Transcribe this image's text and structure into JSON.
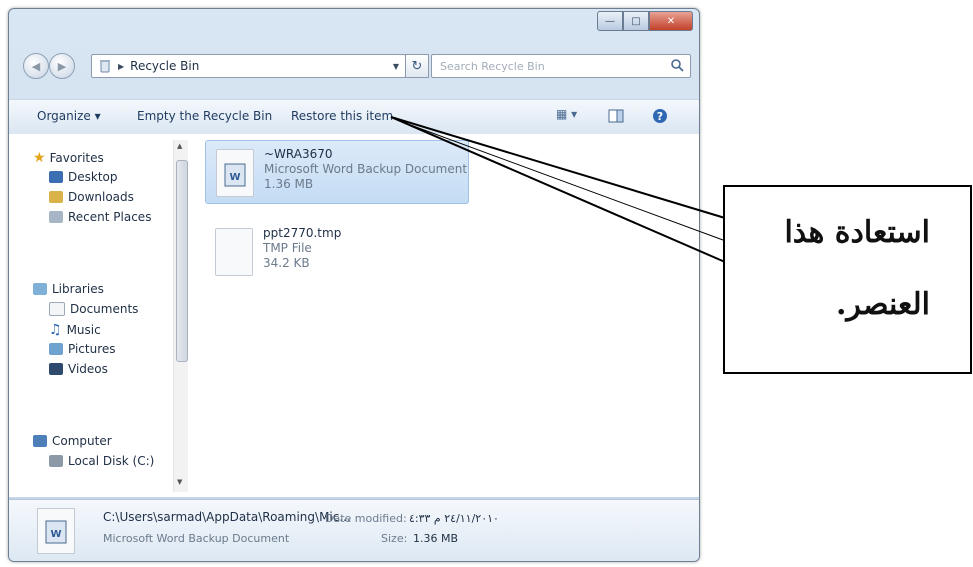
{
  "window": {
    "address": {
      "path": "Recycle Bin"
    },
    "search": {
      "placeholder": "Search Recycle Bin"
    },
    "toolbar": {
      "organize": "Organize ▾",
      "empty": "Empty the Recycle Bin",
      "restore": "Restore this item"
    },
    "nav": {
      "favorites": "Favorites",
      "desktop": "Desktop",
      "downloads": "Downloads",
      "recent": "Recent Places",
      "libraries": "Libraries",
      "documents": "Documents",
      "music": "Music",
      "pictures": "Pictures",
      "videos": "Videos",
      "computer": "Computer",
      "localdisk": "Local Disk (C:)"
    },
    "files": [
      {
        "name": "~WRA3670",
        "type": "Microsoft Word Backup Document",
        "size": "1.36 MB",
        "selected": true
      },
      {
        "name": "ppt2770.tmp",
        "type": "TMP File",
        "size": "34.2 KB",
        "selected": false
      }
    ],
    "details": {
      "path": "C:\\Users\\sarmad\\AppData\\Roaming\\Mic...",
      "type": "Microsoft Word Backup Document",
      "modified_label": "Date modified:",
      "modified_value": "٢٤/١١/٢٠١٠ م ٤:٣٣",
      "size_label": "Size:",
      "size_value": "1.36 MB"
    }
  },
  "callout": {
    "line1": "استعادة هذا",
    "line2": "العنصر."
  },
  "colors": {
    "selection": "#c4dcf4",
    "toolbar_text": "#1f3a5f",
    "close_button": "#c2412a"
  }
}
